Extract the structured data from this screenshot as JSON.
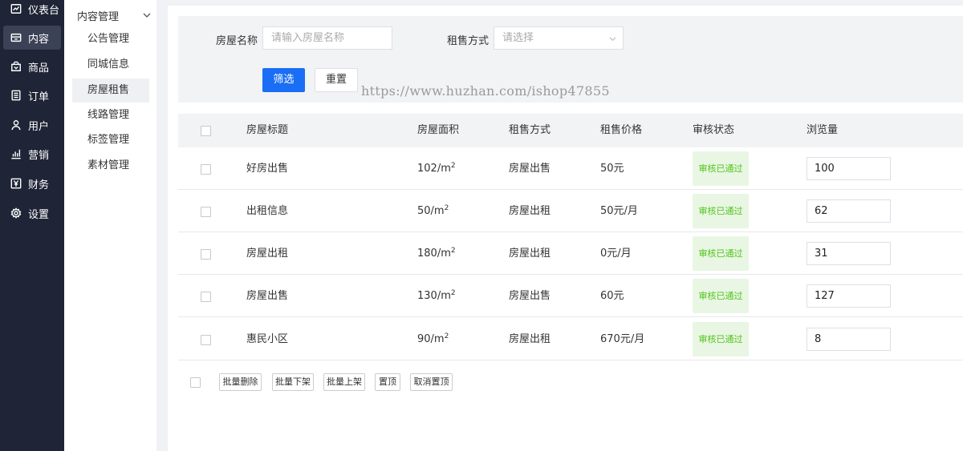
{
  "nav": {
    "items": [
      {
        "label": "仪表台",
        "icon": "dashboard-icon"
      },
      {
        "label": "内容",
        "icon": "content-icon"
      },
      {
        "label": "商品",
        "icon": "goods-icon"
      },
      {
        "label": "订单",
        "icon": "order-icon"
      },
      {
        "label": "用户",
        "icon": "user-icon"
      },
      {
        "label": "营销",
        "icon": "marketing-icon"
      },
      {
        "label": "财务",
        "icon": "finance-icon"
      },
      {
        "label": "设置",
        "icon": "settings-icon"
      }
    ],
    "active_index": 1
  },
  "submenu": {
    "header": "内容管理",
    "items": [
      "公告管理",
      "同城信息",
      "房屋租售",
      "线路管理",
      "标签管理",
      "素材管理"
    ],
    "active_index": 2
  },
  "filter": {
    "name_label": "房屋名称",
    "name_placeholder": "请输入房屋名称",
    "mode_label": "租售方式",
    "mode_placeholder": "请选择",
    "submit_label": "筛选",
    "reset_label": "重置"
  },
  "watermark": "https://www.huzhan.com/ishop47855",
  "table": {
    "headers": [
      "房屋标题",
      "房屋面积",
      "租售方式",
      "租售价格",
      "审核状态",
      "浏览量"
    ],
    "area_unit": "/m",
    "area_sup": "2",
    "rows": [
      {
        "title": "好房出售",
        "area": "102",
        "mode": "房屋出售",
        "price": "50元",
        "status": "审核已通过",
        "views": "100"
      },
      {
        "title": "出租信息",
        "area": "50",
        "mode": "房屋出租",
        "price": "50元/月",
        "status": "审核已通过",
        "views": "62"
      },
      {
        "title": "房屋出租",
        "area": "180",
        "mode": "房屋出租",
        "price": "0元/月",
        "status": "审核已通过",
        "views": "31"
      },
      {
        "title": "房屋出售",
        "area": "130",
        "mode": "房屋出售",
        "price": "60元",
        "status": "审核已通过",
        "views": "127"
      },
      {
        "title": "惠民小区",
        "area": "90",
        "mode": "房屋出租",
        "price": "670元/月",
        "status": "审核已通过",
        "views": "8"
      }
    ]
  },
  "batch": {
    "delete": "批量删除",
    "off_shelf": "批量下架",
    "on_shelf": "批量上架",
    "pin": "置顶",
    "unpin": "取消置顶"
  },
  "colors": {
    "nav_bg": "#1f2436",
    "primary": "#1a6ef5",
    "status_green": "#52c41a",
    "status_bg": "#e8f6e3"
  }
}
